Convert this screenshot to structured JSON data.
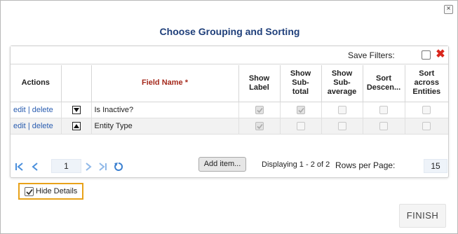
{
  "dialog": {
    "title": "Choose Grouping and Sorting",
    "close_label": "×"
  },
  "toolbar": {
    "save_filters_label": "Save Filters:",
    "save_filters_checked": false,
    "clear_icon": "red-x-icon"
  },
  "grid": {
    "headers": {
      "actions": "Actions",
      "sort": "",
      "field_name": "Field Name *",
      "show_label": [
        "Show",
        "Label"
      ],
      "show_subtotal": [
        "Show",
        "Sub-",
        "total"
      ],
      "show_subaverage": [
        "Show",
        "Sub-",
        "average"
      ],
      "sort_descending": [
        "Sort",
        "Descen..."
      ],
      "sort_across_entities": [
        "Sort",
        "across",
        "Entities"
      ]
    },
    "rows": [
      {
        "edit": "edit",
        "sep": "|",
        "delete": "delete",
        "sort_direction": "descending",
        "sort_icon": "triangle-down-icon",
        "field_name": "Is Inactive?",
        "show_label": true,
        "show_subtotal": true,
        "show_subaverage": false,
        "sort_descending": false,
        "sort_across_entities": false
      },
      {
        "edit": "edit",
        "sep": "|",
        "delete": "delete",
        "sort_direction": "ascending",
        "sort_icon": "triangle-up-icon",
        "field_name": "Entity Type",
        "show_label": true,
        "show_subtotal": false,
        "show_subaverage": false,
        "sort_descending": false,
        "sort_across_entities": false
      }
    ]
  },
  "pager": {
    "current_page": "1",
    "add_item_label": "Add item...",
    "displaying_text": "Displaying 1 - 2 of 2",
    "rows_per_page_label": "Rows per Page:",
    "rows_per_page_value": "15",
    "icons": [
      "first-page-icon",
      "previous-page-icon",
      "next-page-icon",
      "last-page-icon",
      "refresh-icon"
    ]
  },
  "hide_details": {
    "label": "Hide Details",
    "checked": true
  },
  "footer": {
    "finish_label": "FINISH"
  },
  "colors": {
    "title": "#1f3f7a",
    "field_header": "#a52a1d",
    "link": "#2a5db0",
    "pager_icon": "#4a8fdc",
    "highlight_border": "#e8a21a",
    "clear_icon": "#d9261c"
  }
}
